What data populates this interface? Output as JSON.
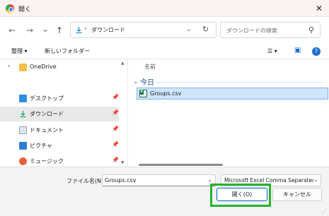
{
  "title": {
    "text": "開く",
    "icon": "chrome-icon"
  },
  "nav": {
    "back_icon": "←",
    "forward_icon": "→",
    "recent_icon": "⌄",
    "up_icon": "↑",
    "address_sep": "›",
    "address_text": "ダウンロード",
    "address_chevron": "⌄",
    "refresh_icon": "↻",
    "search_placeholder": "ダウンロードの検索",
    "search_icon": "⚲"
  },
  "toolbar": {
    "organize": "整理 ▾",
    "new_folder": "新しいフォルダー",
    "view_icon": "☰ ▾",
    "pane_icon": "▣",
    "help_icon": "?"
  },
  "sidebar": {
    "items": [
      {
        "label": "OneDrive",
        "chevron": "›",
        "icon": "folder-icon",
        "color": "#f4c04d",
        "pinned": false
      },
      {
        "label": "デスクトップ",
        "chevron": "",
        "icon": "desktop-icon",
        "color": "#2f8fe0",
        "pinned": true
      },
      {
        "label": "ダウンロード",
        "chevron": "",
        "icon": "download-icon",
        "color": "#1aa260",
        "pinned": true,
        "selected": true
      },
      {
        "label": "ドキュメント",
        "chevron": "",
        "icon": "document-icon",
        "color": "#8aa3b8",
        "pinned": true
      },
      {
        "label": "ピクチャ",
        "chevron": "",
        "icon": "pictures-icon",
        "color": "#2a7fd4",
        "pinned": true
      },
      {
        "label": "ミュージック",
        "chevron": "",
        "icon": "music-icon",
        "color": "#e8603c",
        "pinned": true
      }
    ],
    "pin_glyph": "📌"
  },
  "main": {
    "column_header": "名前",
    "group_label": "今日",
    "group_chevron": "⌄",
    "files": [
      {
        "name": "Groups.csv",
        "icon": "excel-csv-icon",
        "selected": true
      }
    ]
  },
  "footer": {
    "filename_label": "ファイル名(N):",
    "filename_value": "Groups.csv",
    "filetype_value": "Microsoft Excel Comma Separated",
    "open_label": "開く(O)",
    "cancel_label": "キャンセル",
    "highlight_color": "#27b22f"
  },
  "window": {
    "close_icon": "✕"
  }
}
